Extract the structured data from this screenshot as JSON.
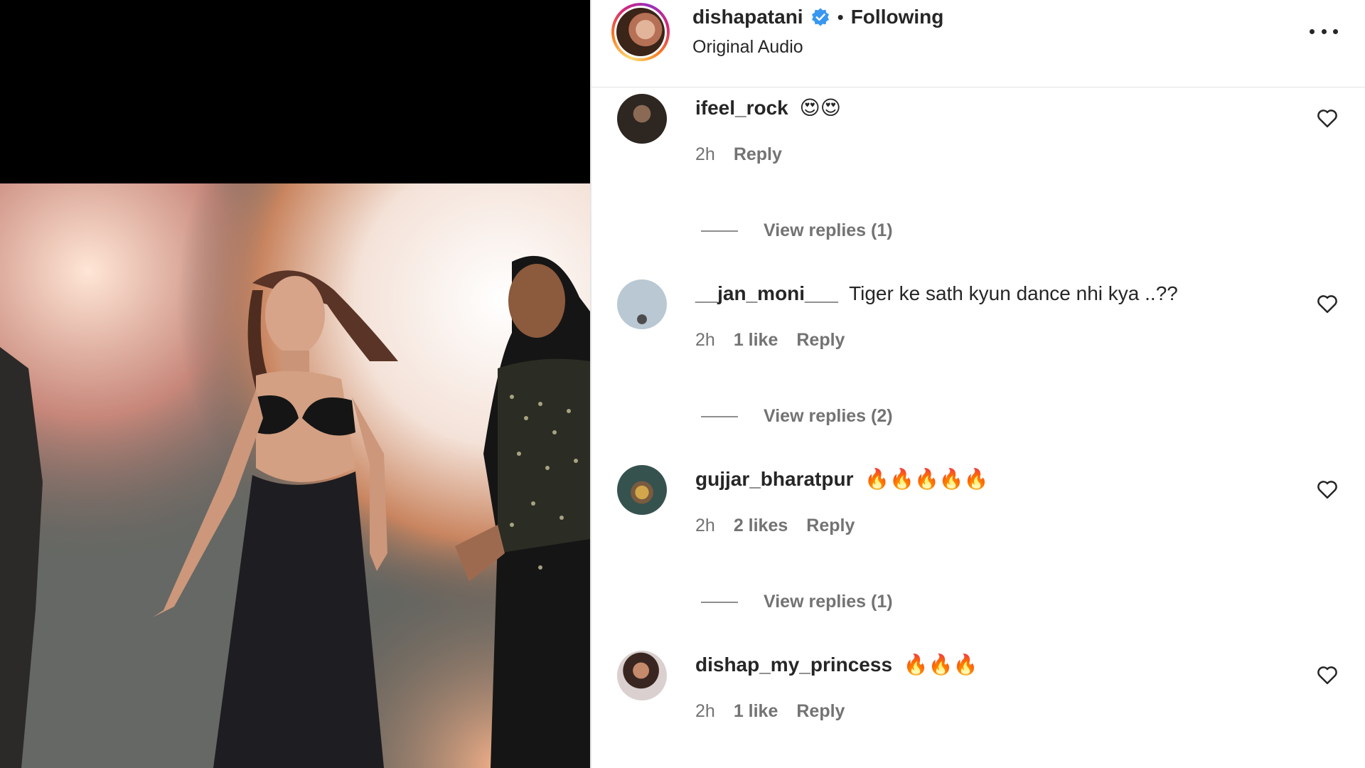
{
  "post": {
    "username": "dishapatani",
    "separator": "•",
    "follow_status": "Following",
    "audio": "Original Audio",
    "more_icon": "more-horizontal-icon",
    "verified_color": "#3897f0"
  },
  "comments": [
    {
      "username": "ifeel_rock",
      "text": "😍😍",
      "time": "2h",
      "likes": "",
      "reply_label": "Reply",
      "view_replies": "View replies (1)"
    },
    {
      "username": "__jan_moni___",
      "text": "Tiger ke sath kyun dance nhi kya ..??",
      "time": "2h",
      "likes": "1 like",
      "reply_label": "Reply",
      "view_replies": "View replies (2)"
    },
    {
      "username": "gujjar_bharatpur",
      "text": "🔥🔥🔥🔥🔥",
      "time": "2h",
      "likes": "2 likes",
      "reply_label": "Reply",
      "view_replies": "View replies (1)"
    },
    {
      "username": "dishap_my_princess",
      "text": "🔥🔥🔥",
      "time": "2h",
      "likes": "1 like",
      "reply_label": "Reply",
      "view_replies": ""
    }
  ]
}
